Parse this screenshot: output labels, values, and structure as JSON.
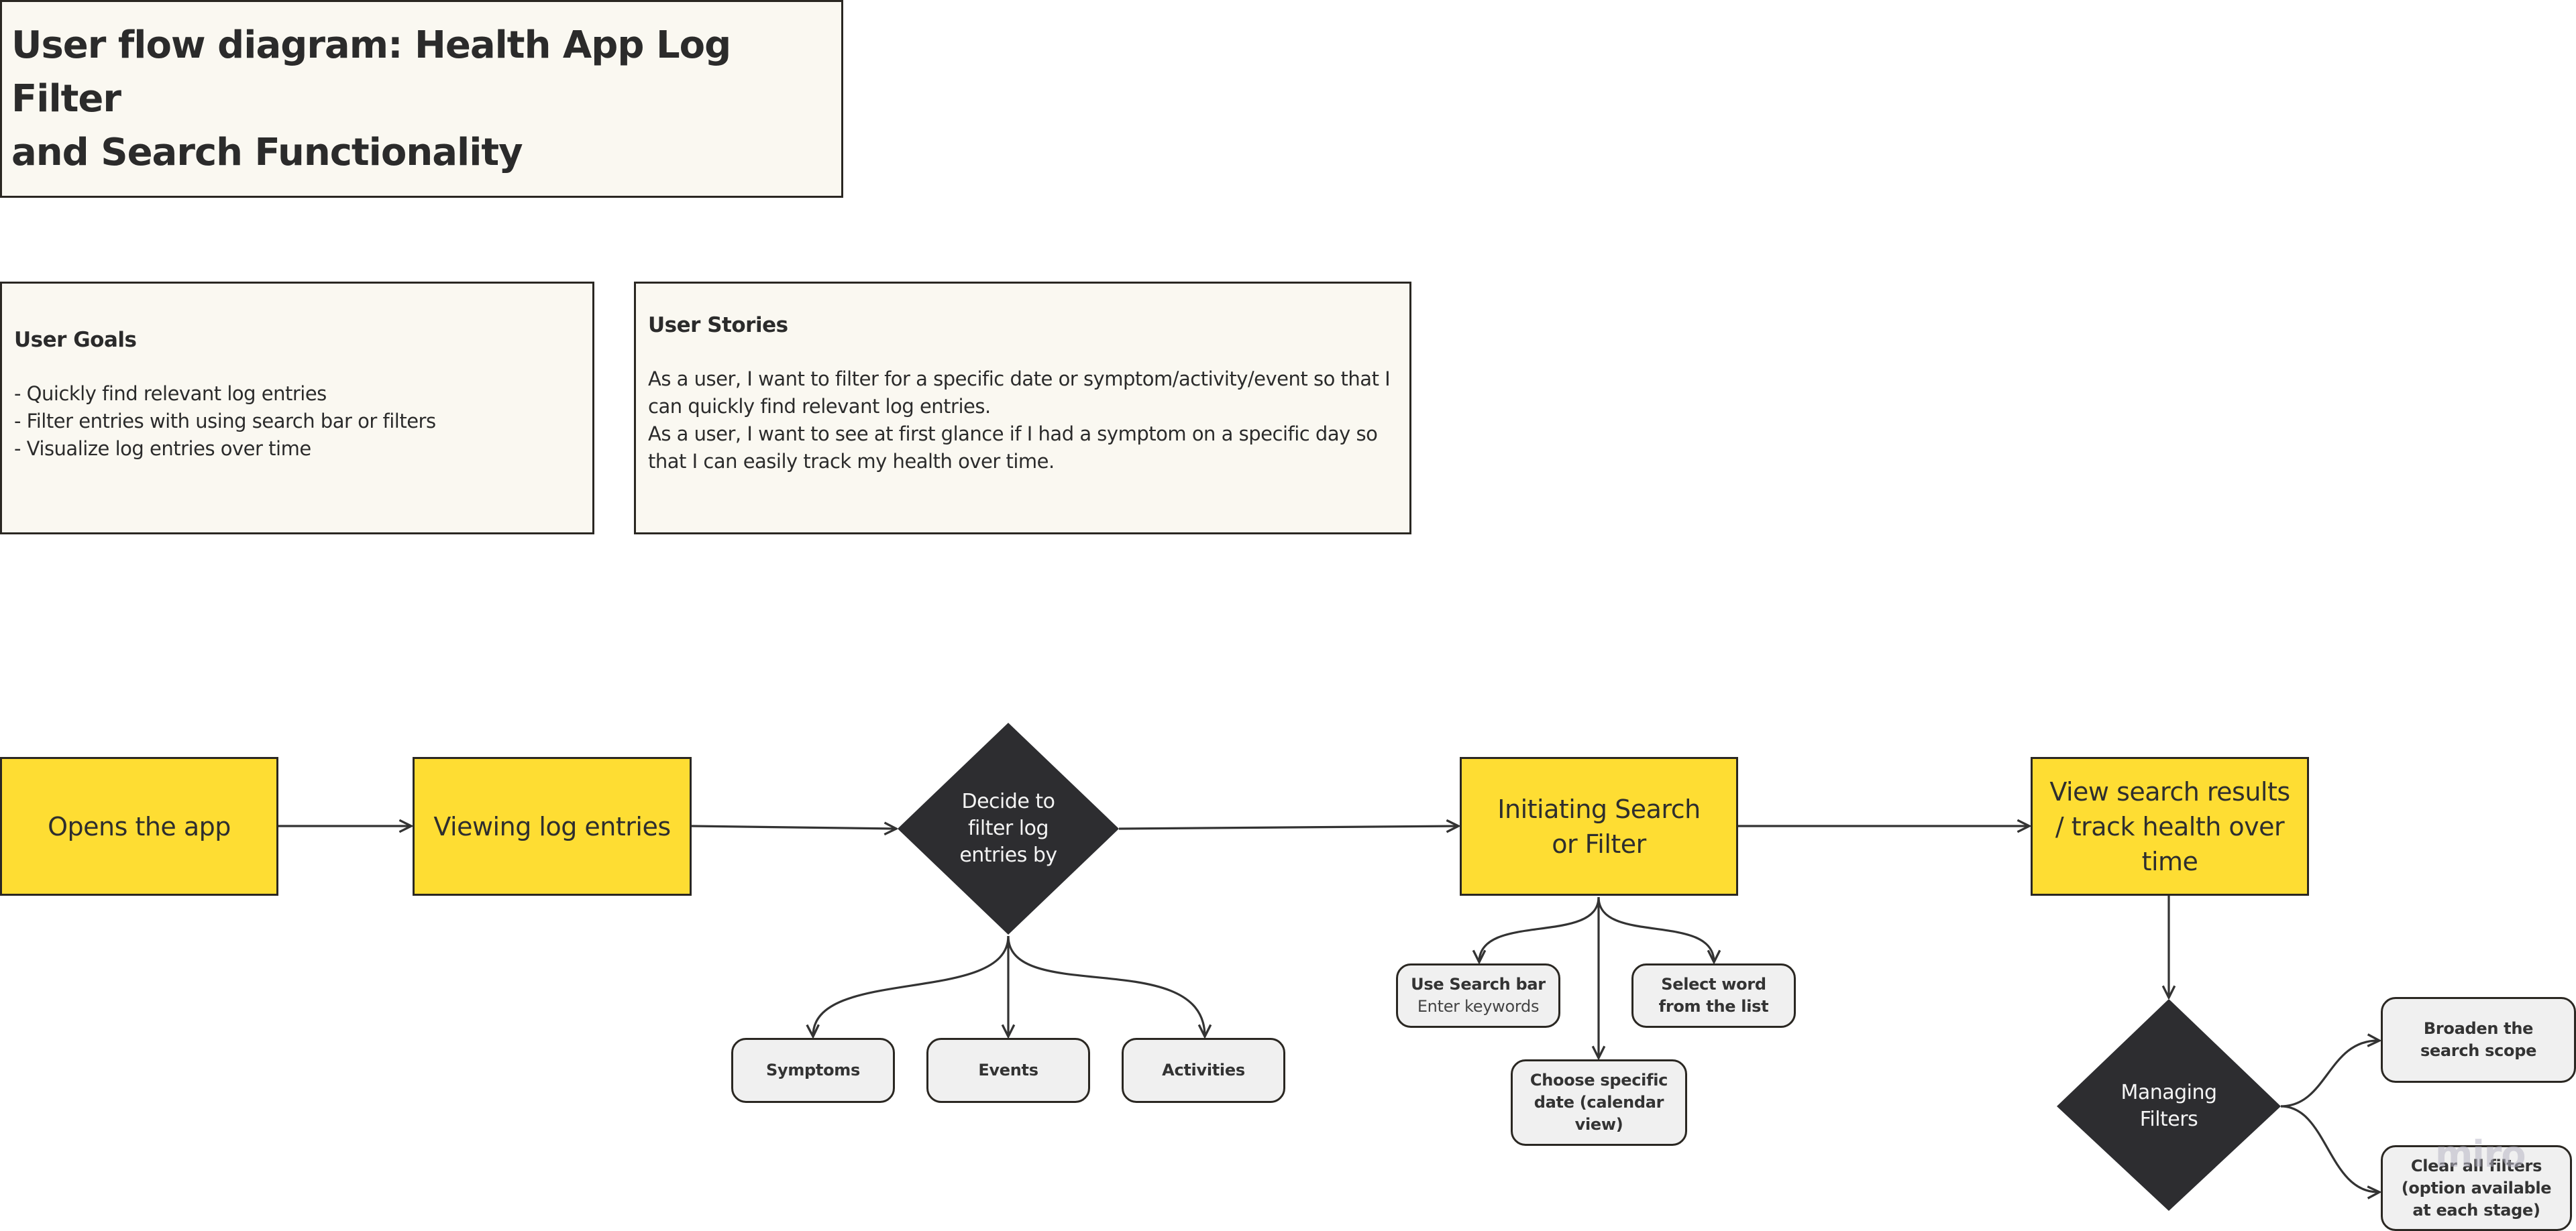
{
  "title": "User flow diagram: Health App Log Filter and Search Functionality",
  "title_lines": [
    "User flow diagram: Health App Log Filter",
    "and Search Functionality"
  ],
  "user_goals": {
    "heading": "User Goals",
    "items": [
      "- Quickly find relevant log entries",
      "- Filter entries with using search bar or filters",
      "- Visualize log entries over time"
    ]
  },
  "user_stories": {
    "heading": "User Stories",
    "items": [
      "As a user, I want to filter for a specific date or symptom/activity/event so that I can quickly find relevant log entries.",
      "As a user, I want to see at first glance if I had a symptom on a specific day so that I can easily track my health over time."
    ]
  },
  "flow": {
    "steps": [
      {
        "id": "open-app",
        "label": "Opens the app"
      },
      {
        "id": "viewing-log",
        "label": "Viewing log entries"
      },
      {
        "id": "initiating",
        "label": "Initiating Search or Filter"
      },
      {
        "id": "view-results",
        "label": "View search results / track health over time"
      }
    ],
    "decisions": [
      {
        "id": "decide-filter",
        "label": "Decide to filter log entries by"
      },
      {
        "id": "managing-filters",
        "label": "Managing Filters"
      }
    ],
    "filter_options": [
      "Symptoms",
      "Events",
      "Activities"
    ],
    "search_options": {
      "search_bar": {
        "label": "Use Search bar",
        "sub": "Enter keywords"
      },
      "select_word": {
        "label": "Select word from the list"
      },
      "choose_date": {
        "label": "Choose specific date (calendar view)"
      }
    },
    "manage_options": {
      "broaden": {
        "label": "Broaden the search scope"
      },
      "clear": {
        "label": "Clear all filters (option available at each stage)"
      }
    }
  },
  "colors": {
    "step_fill": "#fedd33",
    "decision_fill": "#2d2d30",
    "note_fill": "#faf8f1",
    "option_fill": "#f0f0f0",
    "stroke": "#2a2722"
  },
  "watermark": "miro"
}
